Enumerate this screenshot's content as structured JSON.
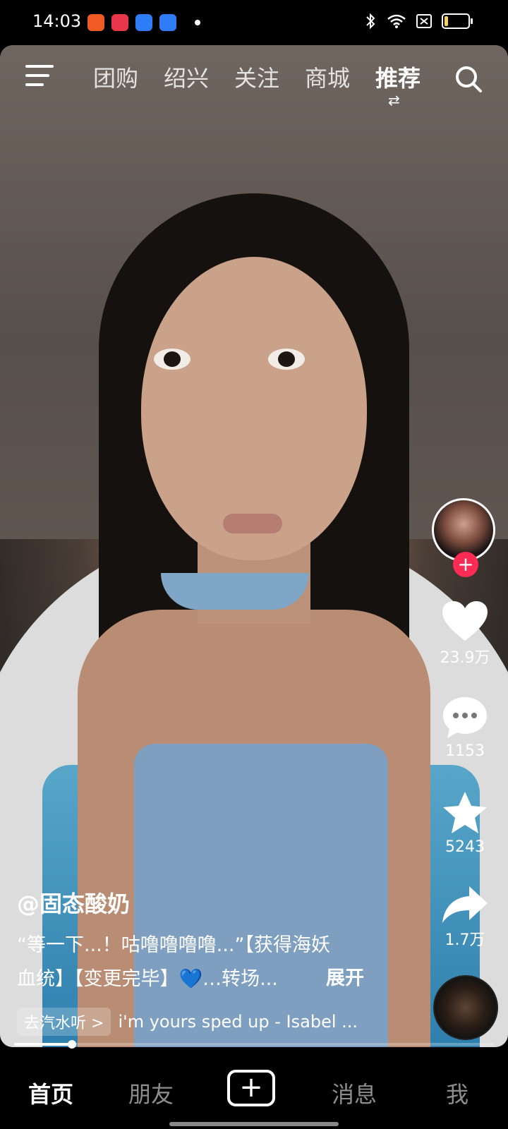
{
  "status_bar": {
    "time": "14:03",
    "icons": [
      "bluetooth-icon",
      "wifi-icon",
      "sim-icon",
      "battery-icon"
    ],
    "battery_level": 0.15,
    "notification_colors": [
      "#f05a24",
      "#e8364a",
      "#2f7df6",
      "#2f7df6"
    ]
  },
  "top_nav": {
    "tabs": [
      "团购",
      "绍兴",
      "关注",
      "商城",
      "推荐"
    ],
    "active_tab": "推荐"
  },
  "actions": {
    "likes": "23.9万",
    "comments": "1153",
    "favorites": "5243",
    "shares": "1.7万"
  },
  "post": {
    "author": "@固态酸奶",
    "caption_line1": "“等一下...！咕噜噜噜噜...”【获得海妖",
    "caption_line2": "血统】【变更完毕】💙…转场...",
    "expand": "展开",
    "music_chip": "去汽水听 >",
    "music_title": "i'm yours sped up - Isabel ...",
    "progress": 0.12
  },
  "bottom_nav": {
    "home": "首页",
    "friends": "朋友",
    "create": "+",
    "messages": "消息",
    "me": "我"
  },
  "colors": {
    "accent": "#fe2c55",
    "text": "#ffffff",
    "background": "#000000"
  }
}
